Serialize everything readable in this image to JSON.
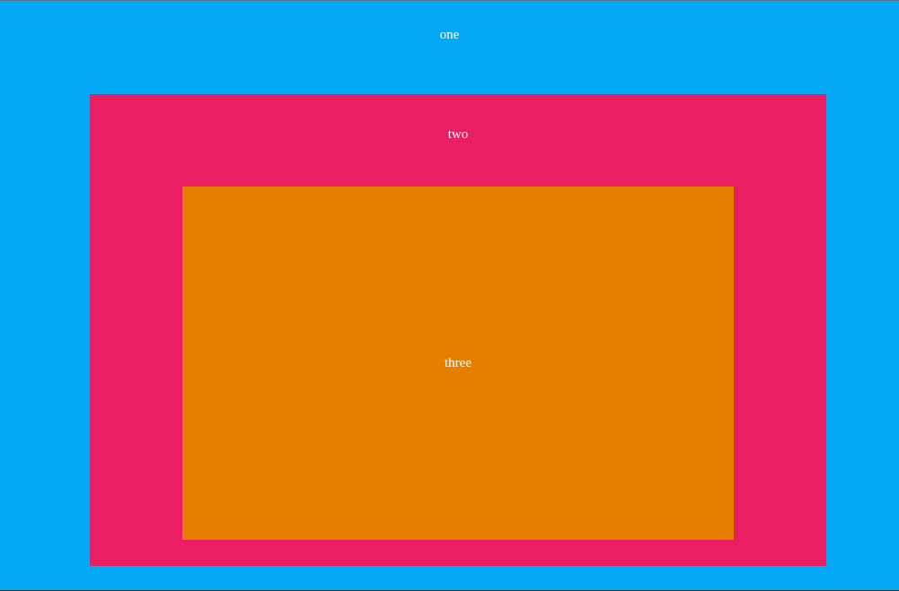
{
  "boxes": {
    "one": {
      "label": "one",
      "color": "#03a9f4"
    },
    "two": {
      "label": "two",
      "color": "#e91e63"
    },
    "three": {
      "label": "three",
      "color": "#e67e00"
    }
  },
  "text_color": "#ffffff"
}
